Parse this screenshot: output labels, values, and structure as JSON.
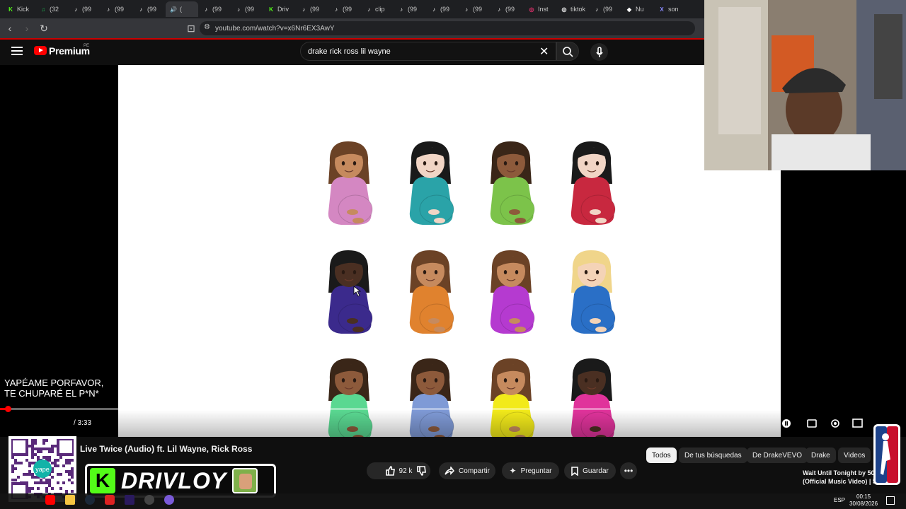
{
  "browser": {
    "tabs": [
      {
        "label": "Kick",
        "color": "#53fc18",
        "glyph": "K"
      },
      {
        "label": "(32",
        "color": "#1db954",
        "glyph": "♫"
      },
      {
        "label": "(99",
        "color": "#ffffff",
        "glyph": "♪"
      },
      {
        "label": "(99",
        "color": "#ffffff",
        "glyph": "♪"
      },
      {
        "label": "(99",
        "color": "#ffffff",
        "glyph": "♪"
      },
      {
        "label": "(",
        "color": "#ffffff",
        "glyph": "🔊"
      },
      {
        "label": "(99",
        "color": "#ffffff",
        "glyph": "♪"
      },
      {
        "label": "(99",
        "color": "#ffffff",
        "glyph": "♪"
      },
      {
        "label": "Driv",
        "color": "#53fc18",
        "glyph": "K"
      },
      {
        "label": "(99",
        "color": "#ffffff",
        "glyph": "♪"
      },
      {
        "label": "(99",
        "color": "#ffffff",
        "glyph": "♪"
      },
      {
        "label": "clip",
        "color": "#ffffff",
        "glyph": "♪"
      },
      {
        "label": "(99",
        "color": "#ffffff",
        "glyph": "♪"
      },
      {
        "label": "(99",
        "color": "#ffffff",
        "glyph": "♪"
      },
      {
        "label": "(99",
        "color": "#ffffff",
        "glyph": "♪"
      },
      {
        "label": "(99",
        "color": "#ffffff",
        "glyph": "♪"
      },
      {
        "label": "Inst",
        "color": "#e1306c",
        "glyph": "◎"
      },
      {
        "label": "tiktok",
        "color": "#ffffff",
        "glyph": "◎"
      },
      {
        "label": "(99",
        "color": "#ffffff",
        "glyph": "♪"
      },
      {
        "label": "Nu",
        "color": "#ffffff",
        "glyph": "◆"
      },
      {
        "label": "son",
        "color": "#8a8aff",
        "glyph": "X"
      }
    ],
    "url": "youtube.com/watch?v=x6Nr6EX3AwY"
  },
  "youtube": {
    "brand": "Premium",
    "region": "PE",
    "search_query": "drake rick ross lil wayne",
    "video_title": "Live Twice (Audio) ft. Lil Wayne, Rick Ross",
    "time": "/ 3:33",
    "progress": 0.008,
    "likes": "92 k",
    "actions": {
      "share": "Compartir",
      "ask": "Preguntar",
      "save": "Guardar"
    },
    "chips": [
      "Todos",
      "De tus búsquedas",
      "De DrakeVEVO",
      "Drake",
      "Videos"
    ],
    "recommendation": [
      "Wait Until Tonight by 50",
      "(Official Music Video) | 5"
    ]
  },
  "stream_overlay": {
    "message_line1": "YAPÉAME PORFAVOR,",
    "message_line2": "TE CHUPARÉ  EL P*N*",
    "banner_name": "DRIVLOY",
    "banner_k": "K",
    "qr_label": "yape"
  },
  "emojis": [
    {
      "hair": "#6b4226",
      "skin": "#c68a5e",
      "shirt": "#d487c2"
    },
    {
      "hair": "#1a1a1a",
      "skin": "#f1d5c5",
      "shirt": "#2aa3a8"
    },
    {
      "hair": "#3a2618",
      "skin": "#8d5a3b",
      "shirt": "#7cc34a"
    },
    {
      "hair": "#1a1a1a",
      "skin": "#f1d5c5",
      "shirt": "#c8283f"
    },
    {
      "hair": "#1a1a1a",
      "skin": "#4a2f22",
      "shirt": "#3b2a8c"
    },
    {
      "hair": "#6b4226",
      "skin": "#c68a5e",
      "shirt": "#e0822e"
    },
    {
      "hair": "#6b4226",
      "skin": "#c68a5e",
      "shirt": "#b53ad0"
    },
    {
      "hair": "#f0d58a",
      "skin": "#f4d3b7",
      "shirt": "#2a6fc6"
    },
    {
      "hair": "#3a2618",
      "skin": "#8d5a3b",
      "shirt": "#5ad891"
    },
    {
      "hair": "#3a2618",
      "skin": "#8d5a3b",
      "shirt": "#7f9ad6"
    },
    {
      "hair": "#6b4226",
      "skin": "#c68a5e",
      "shirt": "#f2ea1a"
    },
    {
      "hair": "#1a1a1a",
      "skin": "#4a2f22",
      "shirt": "#e0339b"
    }
  ],
  "taskbar": {
    "lang": "ESP",
    "time": "00:15",
    "date": "30/08/2026"
  }
}
